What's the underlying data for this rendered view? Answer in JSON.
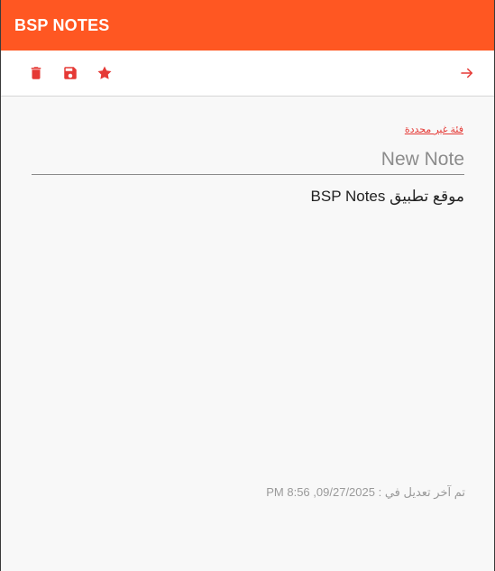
{
  "header": {
    "title": "BSP NOTES"
  },
  "toolbar": {
    "delete_icon": "trash-icon",
    "save_icon": "floppy-disk-icon",
    "favorite_icon": "star-icon",
    "back_icon": "arrow-right-icon"
  },
  "note": {
    "category_label": "فئة غير محددة",
    "title_placeholder": "New Note",
    "title_value": "",
    "body": "موقع تطبيق BSP Notes",
    "last_modified_label": "تم آخر تعديل في :",
    "last_modified_value": "09/27/2025, 8:56 PM"
  },
  "colors": {
    "header_bg": "#ff5722",
    "accent": "#e53935",
    "background": "#f8f8f8"
  }
}
